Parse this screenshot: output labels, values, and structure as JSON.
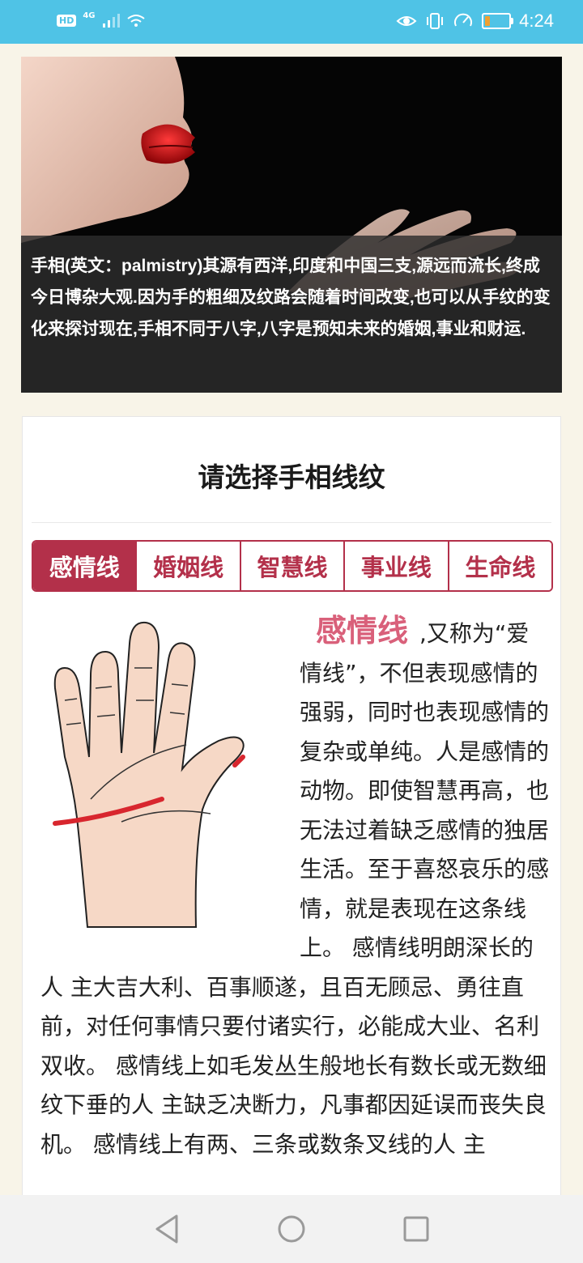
{
  "status_bar": {
    "left_badge": "HD",
    "network": "4G",
    "time": "4:24",
    "battery_percent": 20,
    "icons": [
      "eye-icon",
      "vibrate-icon",
      "speed-icon",
      "battery-icon"
    ]
  },
  "hero": {
    "caption": "手相(英文：palmistry)其源有西洋,印度和中国三支,源远而流长,终成今日博杂大观.因为手的粗细及纹路会随着时间改变,也可以从手纹的变化来探讨现在,手相不同于八字,八字是预知未来的婚姻,事业和财运."
  },
  "card": {
    "title": "请选择手相线纹",
    "tabs": [
      {
        "label": "感情线",
        "active": true
      },
      {
        "label": "婚姻线",
        "active": false
      },
      {
        "label": "智慧线",
        "active": false
      },
      {
        "label": "事业线",
        "active": false
      },
      {
        "label": "生命线",
        "active": false
      }
    ],
    "line_name": "感情线",
    "description": ",又称为“爱情线”，不但表现感情的强弱，同时也表现感情的复杂或单纯。人是感情的动物。即使智慧再高，也无法过着缺乏感情的独居生活。至于喜怒哀乐的感情，就是表现在这条线上。 感情线明朗深长的人 主大吉大利、百事顺遂，且百无顾忌、勇往直前，对任何事情只要付诸实行，必能成大业、名利双收。 感情线上如毛发丛生般地长有数长或无数细纹下垂的人 主缺乏决断力，凡事都因延误而丧失良机。 感情线上有两、三条或数条叉线的人 主"
  },
  "colors": {
    "status_bar": "#4fc3e6",
    "accent": "#b3304a",
    "line_name": "#d9607a",
    "page_bg": "#f8f4e8"
  },
  "nav_bar": {
    "icons": [
      "back-icon",
      "home-icon",
      "recents-icon"
    ]
  }
}
